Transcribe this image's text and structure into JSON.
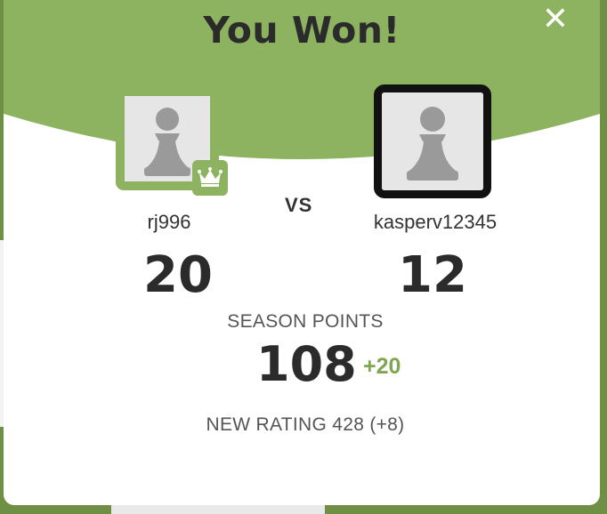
{
  "modal": {
    "title": "You Won!",
    "close_icon": "close-icon"
  },
  "players": {
    "left": {
      "name": "rj996",
      "score": "20",
      "avatar_icon": "pawn-icon",
      "badge_icon": "crown-icon"
    },
    "right": {
      "name": "kasperv12345",
      "score": "12",
      "avatar_icon": "pawn-icon"
    }
  },
  "vs_label": "VS",
  "season": {
    "label": "SEASON POINTS",
    "points": "108",
    "delta": "+20"
  },
  "rating": {
    "text": "NEW RATING 428 (+8)"
  },
  "colors": {
    "accent_green": "#8db360",
    "delta_green": "#7fa650",
    "text_dark": "#2b2b2b"
  }
}
